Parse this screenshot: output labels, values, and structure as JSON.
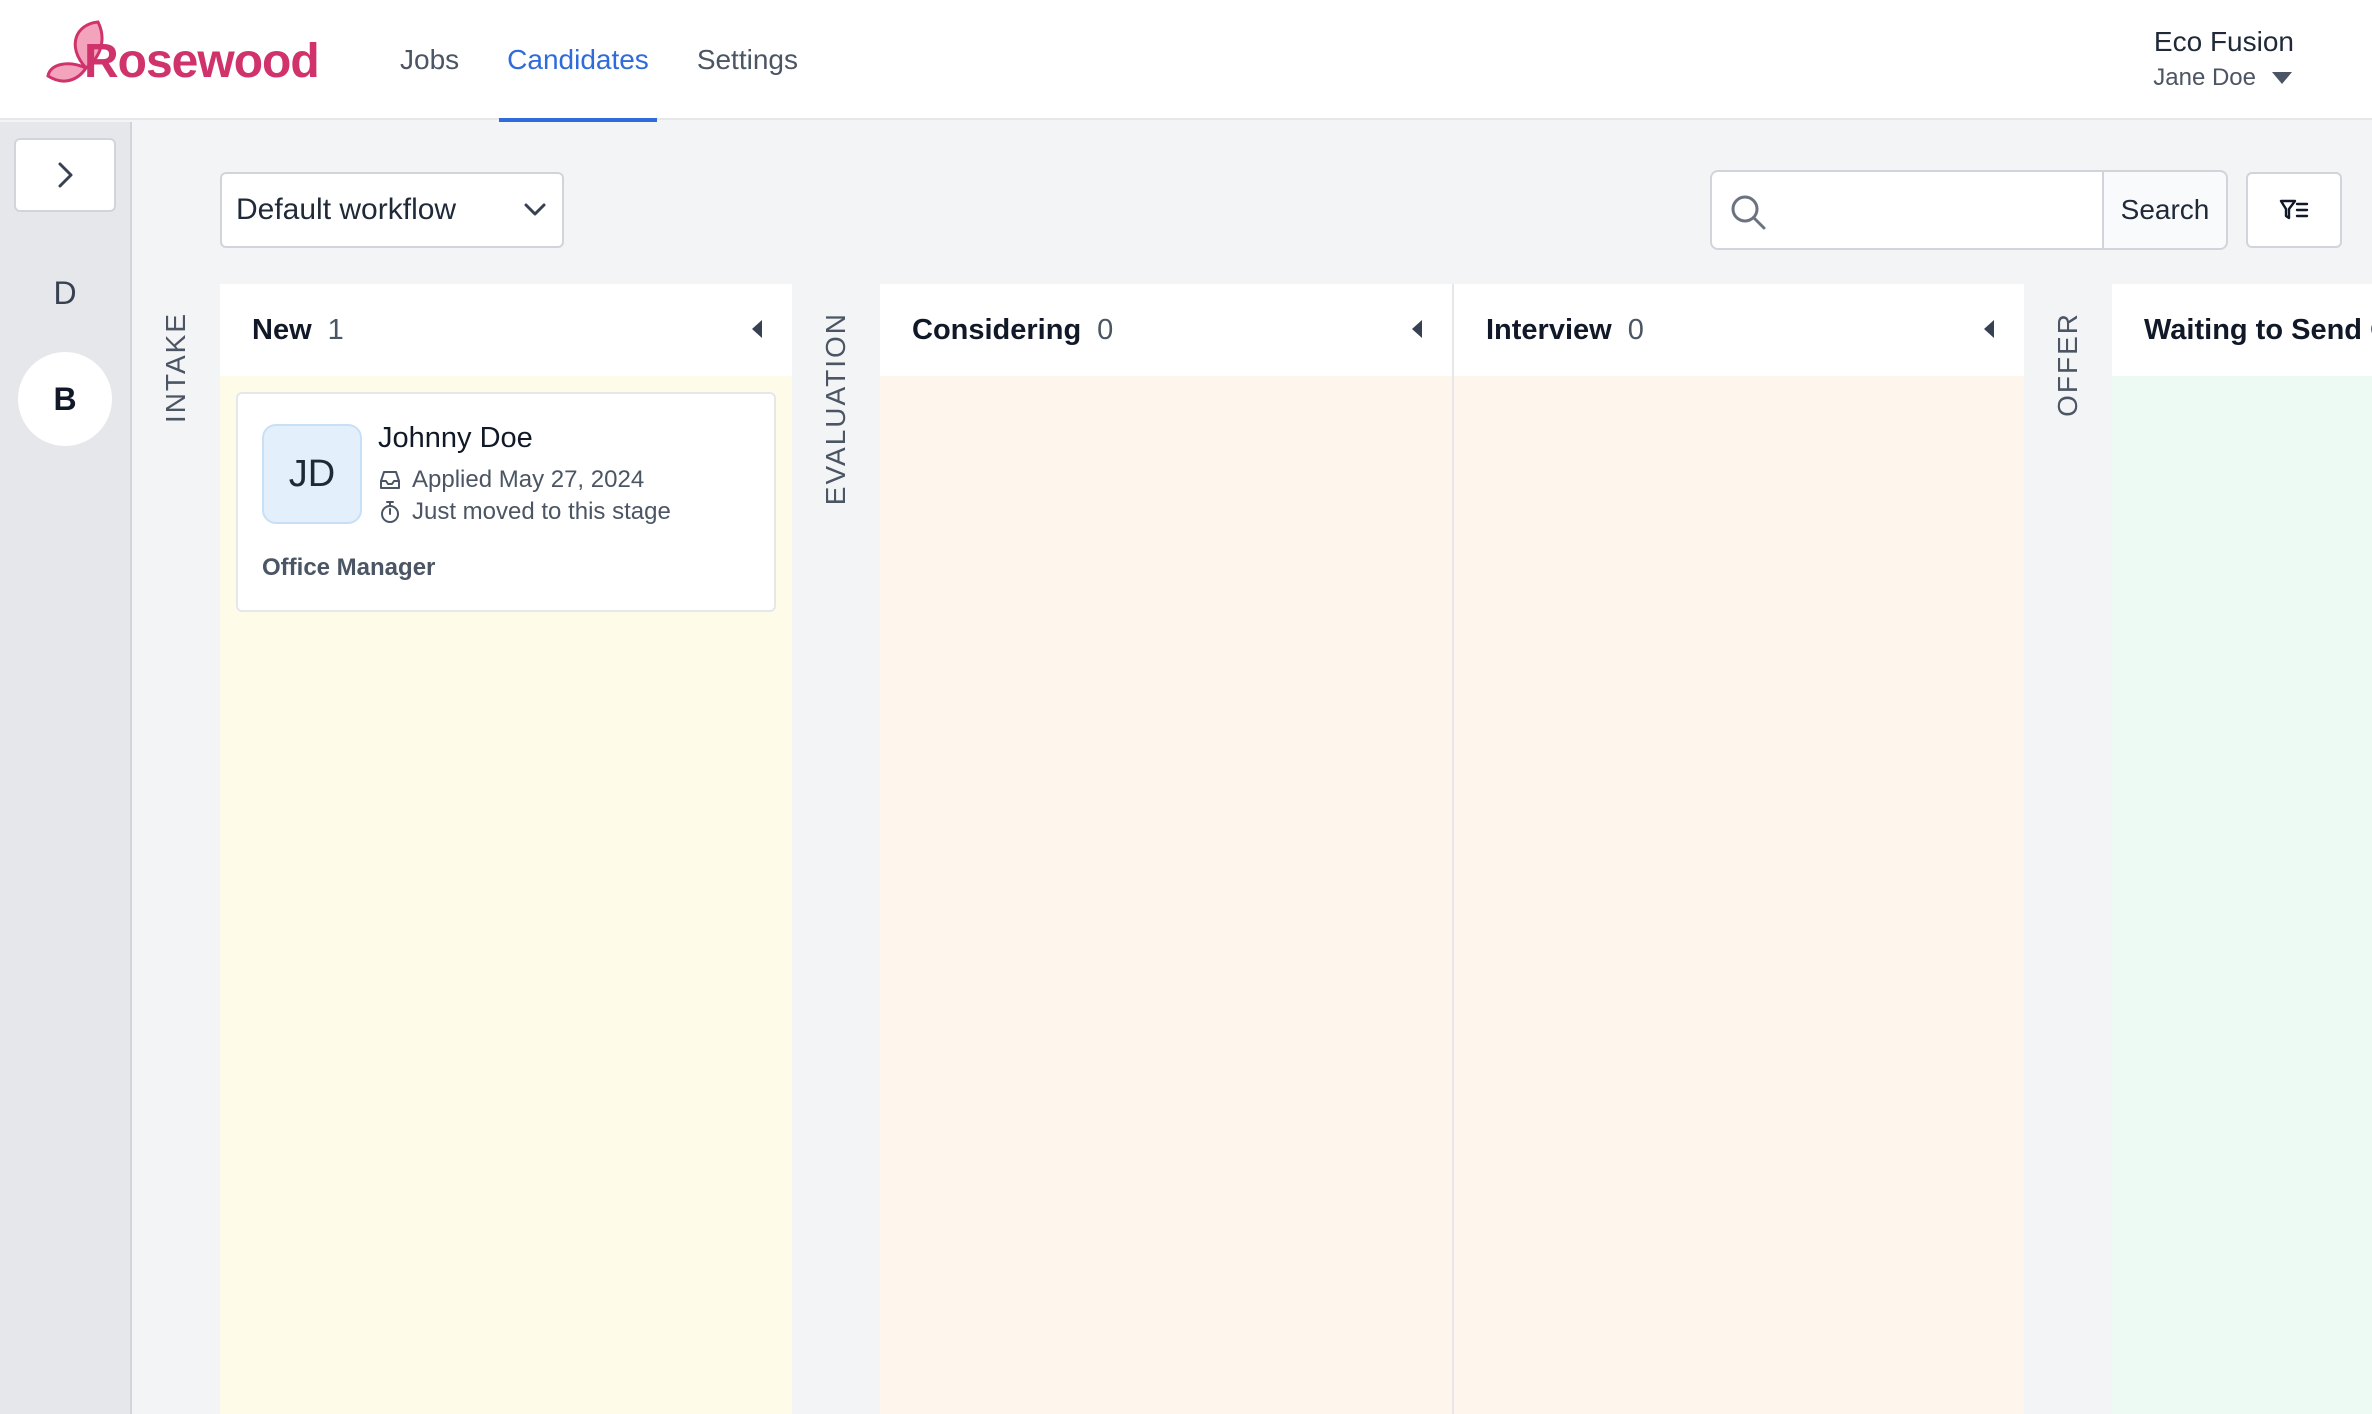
{
  "app": {
    "brand": "Rosewood"
  },
  "nav": {
    "items": [
      {
        "label": "Jobs",
        "active": false
      },
      {
        "label": "Candidates",
        "active": true
      },
      {
        "label": "Settings",
        "active": false
      }
    ]
  },
  "account": {
    "org": "Eco Fusion",
    "user": "Jane Doe"
  },
  "rail": {
    "letters": [
      "D",
      "B"
    ]
  },
  "toolbar": {
    "workflow": "Default workflow",
    "search_value": "",
    "search_button": "Search"
  },
  "board": {
    "groups": [
      "INTAKE",
      "EVALUATION",
      "OFFER"
    ],
    "columns": [
      {
        "title": "New",
        "count": "1",
        "bg": "#fefce8"
      },
      {
        "title": "Considering",
        "count": "0",
        "bg": "#fef6ec"
      },
      {
        "title": "Interview",
        "count": "0",
        "bg": "#fef6ec"
      },
      {
        "title": "Waiting to Send Offer",
        "count": "",
        "bg": "#edfaf3"
      }
    ],
    "card": {
      "initials": "JD",
      "name": "Johnny Doe",
      "applied": "Applied May 27, 2024",
      "stage_note": "Just moved to this stage",
      "job": "Office Manager"
    }
  },
  "colors": {
    "accent": "#2f6bdb",
    "brand": "#d0336b"
  }
}
